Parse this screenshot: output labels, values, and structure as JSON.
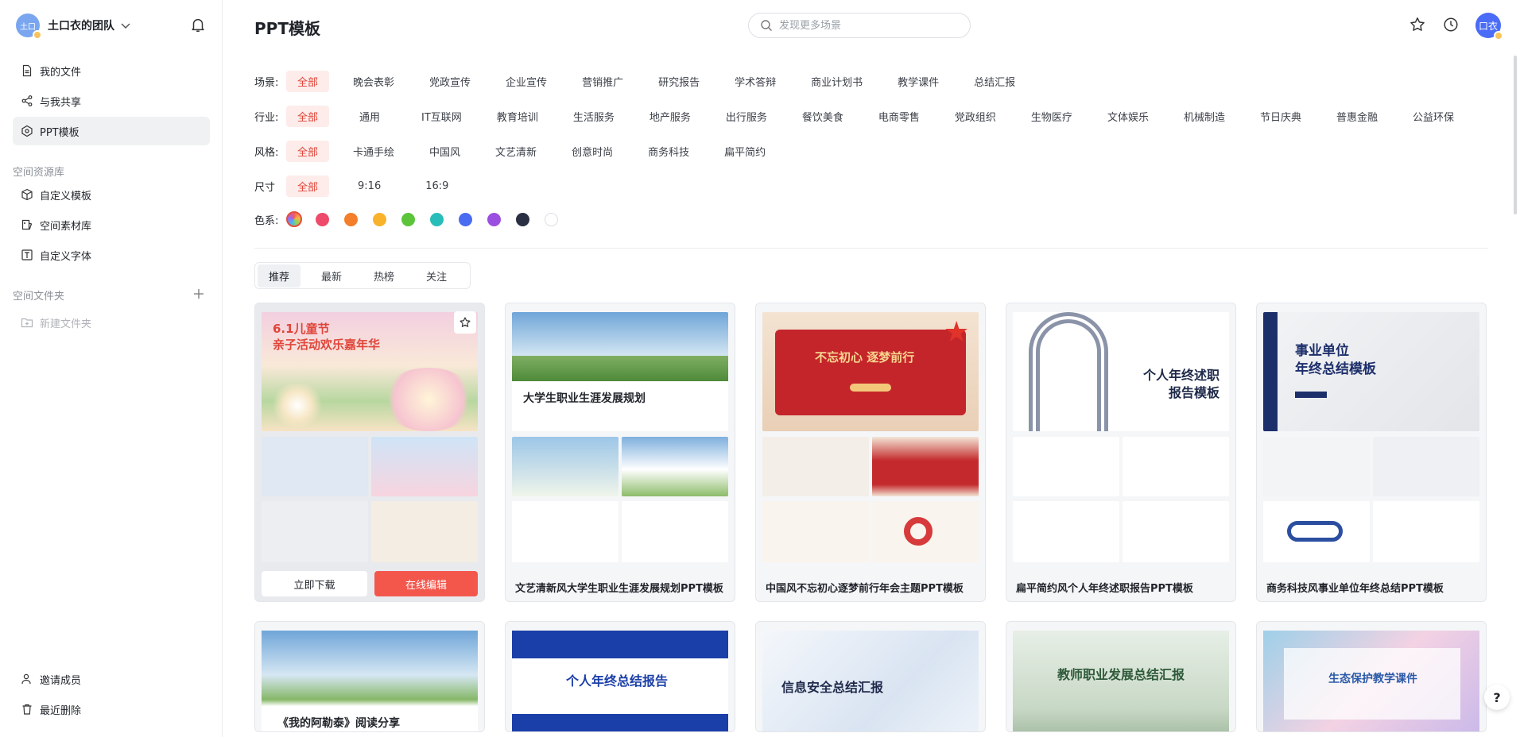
{
  "team": {
    "avatar_text": "土口",
    "name": "土口衣的团队"
  },
  "nav": {
    "my_files": "我的文件",
    "shared": "与我共享",
    "ppt_templates": "PPT模板"
  },
  "resources": {
    "section": "空间资源库",
    "custom_templates": "自定义模板",
    "materials": "空间素材库",
    "custom_fonts": "自定义字体"
  },
  "folders": {
    "section": "空间文件夹",
    "new_folder": "新建文件夹"
  },
  "footer": {
    "invite": "邀请成员",
    "recent_deleted": "最近删除"
  },
  "header": {
    "title": "PPT模板",
    "search_placeholder": "发现更多场景",
    "user_avatar_text": "口衣"
  },
  "filters": {
    "scene": {
      "label": "场景:",
      "options": [
        "全部",
        "晚会表彰",
        "党政宣传",
        "企业宣传",
        "营销推广",
        "研究报告",
        "学术答辩",
        "商业计划书",
        "教学课件",
        "总结汇报"
      ]
    },
    "industry": {
      "label": "行业:",
      "options": [
        "全部",
        "通用",
        "IT互联网",
        "教育培训",
        "生活服务",
        "地产服务",
        "出行服务",
        "餐饮美食",
        "电商零售",
        "党政组织",
        "生物医疗",
        "文体娱乐",
        "机械制造",
        "节日庆典",
        "普惠金融",
        "公益环保"
      ]
    },
    "style": {
      "label": "风格:",
      "options": [
        "全部",
        "卡通手绘",
        "中国风",
        "文艺清新",
        "创意时尚",
        "商务科技",
        "扁平简约"
      ]
    },
    "size": {
      "label": "尺寸",
      "options": [
        "全部",
        "9:16",
        "16:9"
      ]
    },
    "color": {
      "label": "色系:",
      "swatches": [
        "#ee4a6a",
        "#f47f2a",
        "#f8b32a",
        "#5cc43a",
        "#28bdb8",
        "#4a6cf0",
        "#9b4fe0",
        "#2a2f44",
        "#ffffff"
      ]
    }
  },
  "tabs": [
    "推荐",
    "最新",
    "热榜",
    "关注"
  ],
  "cards": [
    {
      "title": "6.1儿童节亲子活动欢乐嘉年华",
      "hero_line1": "6.1儿童节",
      "hero_line2": "亲子活动欢乐嘉年华",
      "download": "立即下载",
      "edit": "在线编辑"
    },
    {
      "title": "文艺清新风大学生职业生涯发展规划PPT模板",
      "hero": "大学生职业生涯发展规划"
    },
    {
      "title": "中国风不忘初心逐梦前行年会主题PPT模板",
      "hero": "不忘初心 逐梦前行"
    },
    {
      "title": "扁平简约风个人年终述职报告PPT模板",
      "hero_line1": "个人年终述职",
      "hero_line2": "报告模板"
    },
    {
      "title": "商务科技风事业单位年终总结PPT模板",
      "hero_line1": "事业单位",
      "hero_line2": "年终总结模板"
    }
  ],
  "cards_row2": [
    {
      "hero": "《我的阿勒泰》阅读分享"
    },
    {
      "hero": "个人年终总结报告"
    },
    {
      "hero": "信息安全总结汇报"
    },
    {
      "hero": "教师职业发展总结汇报"
    },
    {
      "hero": "生态保护教学课件"
    }
  ],
  "help": "?"
}
